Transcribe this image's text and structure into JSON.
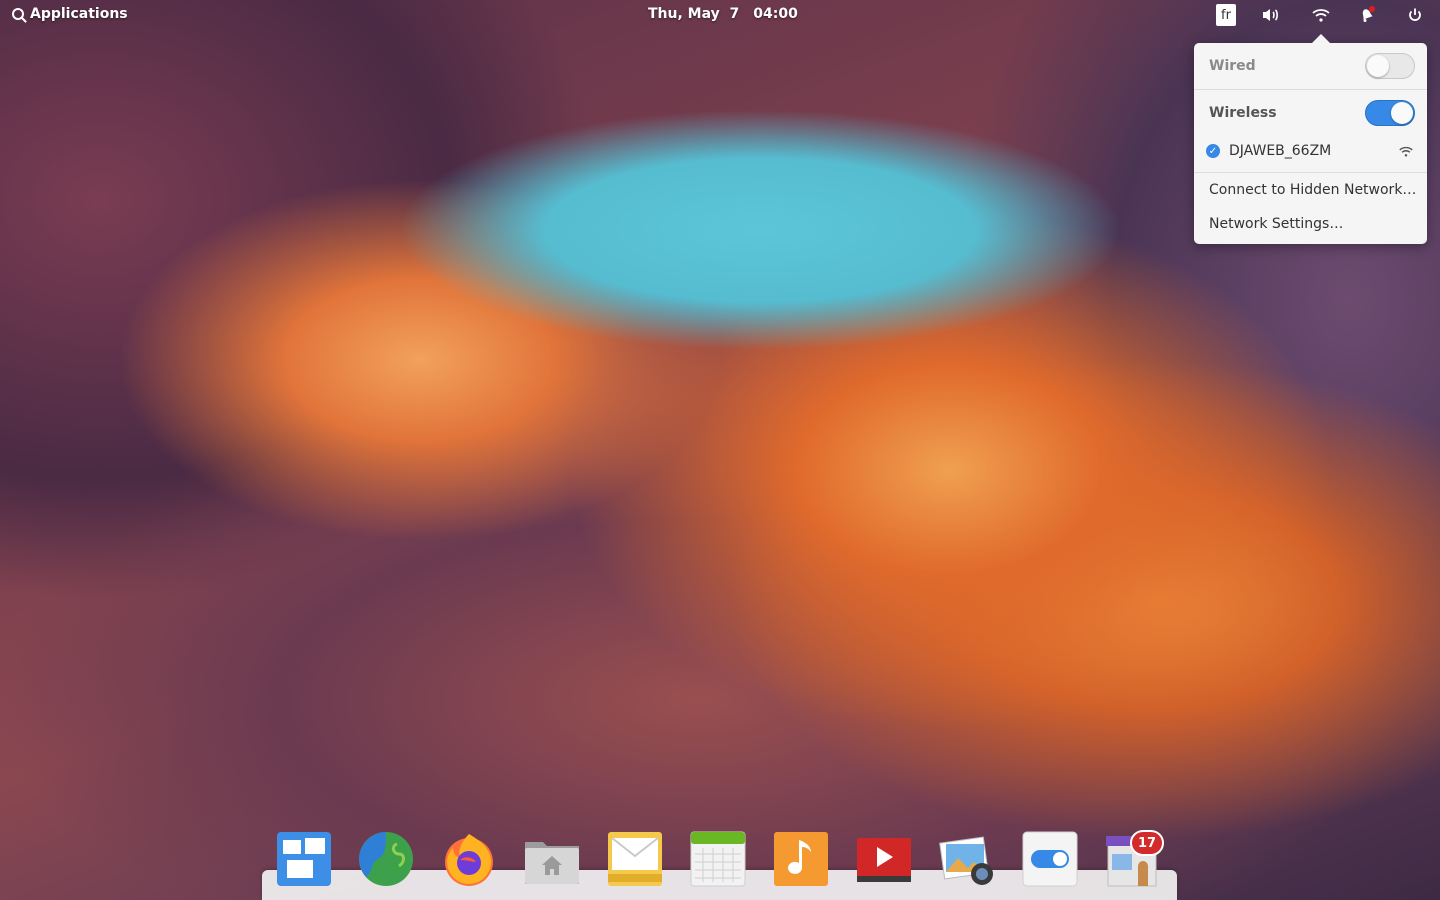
{
  "panel": {
    "applications_label": "Applications",
    "date": "Thu, May  7",
    "time": "04:00",
    "keyboard_layout": "fr"
  },
  "network_popover": {
    "wired": {
      "label": "Wired",
      "enabled": false
    },
    "wireless": {
      "label": "Wireless",
      "enabled": true
    },
    "networks": [
      {
        "ssid": "DJAWEB_66ZM",
        "connected": true
      }
    ],
    "menu": {
      "hidden_network": "Connect to Hidden Network…",
      "settings": "Network Settings…"
    }
  },
  "dock": {
    "apps": [
      {
        "name": "multitasking-view-icon"
      },
      {
        "name": "web-browser-icon"
      },
      {
        "name": "firefox-icon"
      },
      {
        "name": "files-icon"
      },
      {
        "name": "mail-icon"
      },
      {
        "name": "calendar-icon"
      },
      {
        "name": "music-icon"
      },
      {
        "name": "videos-icon"
      },
      {
        "name": "photos-icon"
      },
      {
        "name": "system-settings-icon"
      },
      {
        "name": "appcenter-icon"
      }
    ],
    "appcenter_badge": "17"
  },
  "colors": {
    "accent": "#3689e6",
    "badge": "#d32a2a"
  }
}
